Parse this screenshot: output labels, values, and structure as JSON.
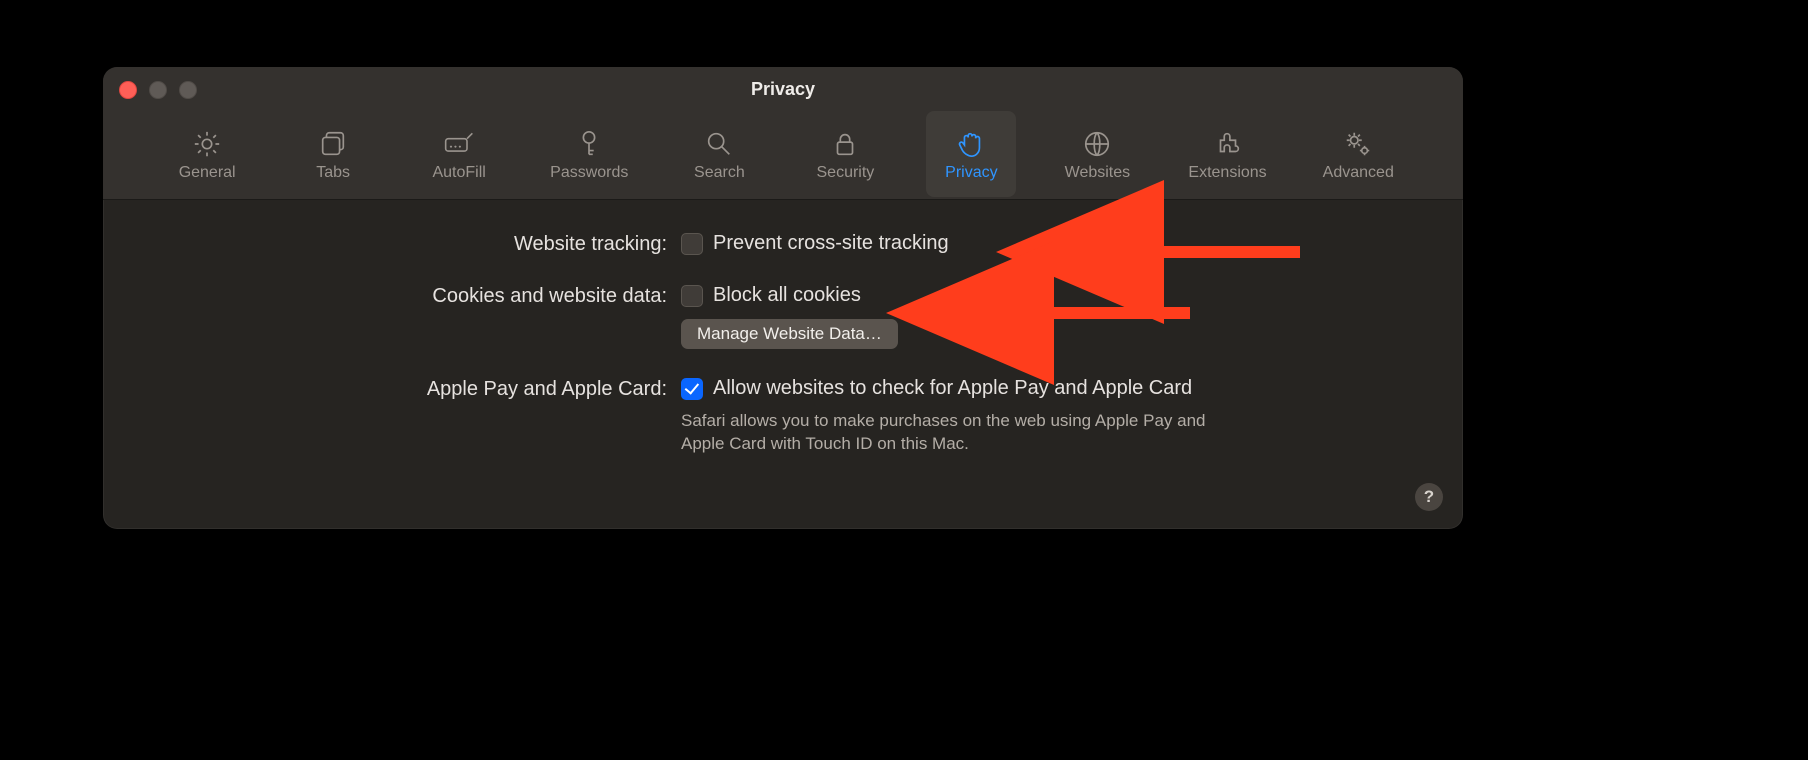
{
  "window": {
    "title": "Privacy"
  },
  "toolbar": {
    "items": [
      {
        "id": "general",
        "label": "General",
        "active": false
      },
      {
        "id": "tabs",
        "label": "Tabs",
        "active": false
      },
      {
        "id": "autofill",
        "label": "AutoFill",
        "active": false
      },
      {
        "id": "passwords",
        "label": "Passwords",
        "active": false
      },
      {
        "id": "search",
        "label": "Search",
        "active": false
      },
      {
        "id": "security",
        "label": "Security",
        "active": false
      },
      {
        "id": "privacy",
        "label": "Privacy",
        "active": true
      },
      {
        "id": "websites",
        "label": "Websites",
        "active": false
      },
      {
        "id": "extensions",
        "label": "Extensions",
        "active": false
      },
      {
        "id": "advanced",
        "label": "Advanced",
        "active": false
      }
    ]
  },
  "sections": {
    "tracking": {
      "label": "Website tracking:",
      "option": "Prevent cross-site tracking",
      "checked": false
    },
    "cookies": {
      "label": "Cookies and website data:",
      "option": "Block all cookies",
      "checked": false,
      "button": "Manage Website Data…"
    },
    "applepay": {
      "label": "Apple Pay and Apple Card:",
      "option": "Allow websites to check for Apple Pay and Apple Card",
      "checked": true,
      "helper": "Safari allows you to make purchases on the web using Apple Pay and Apple Card with Touch ID on this Mac."
    }
  },
  "help_label": "?",
  "colors": {
    "accent": "#0a66ff",
    "active_tint": "#2f95ff",
    "annotation": "#ff3d1c"
  }
}
